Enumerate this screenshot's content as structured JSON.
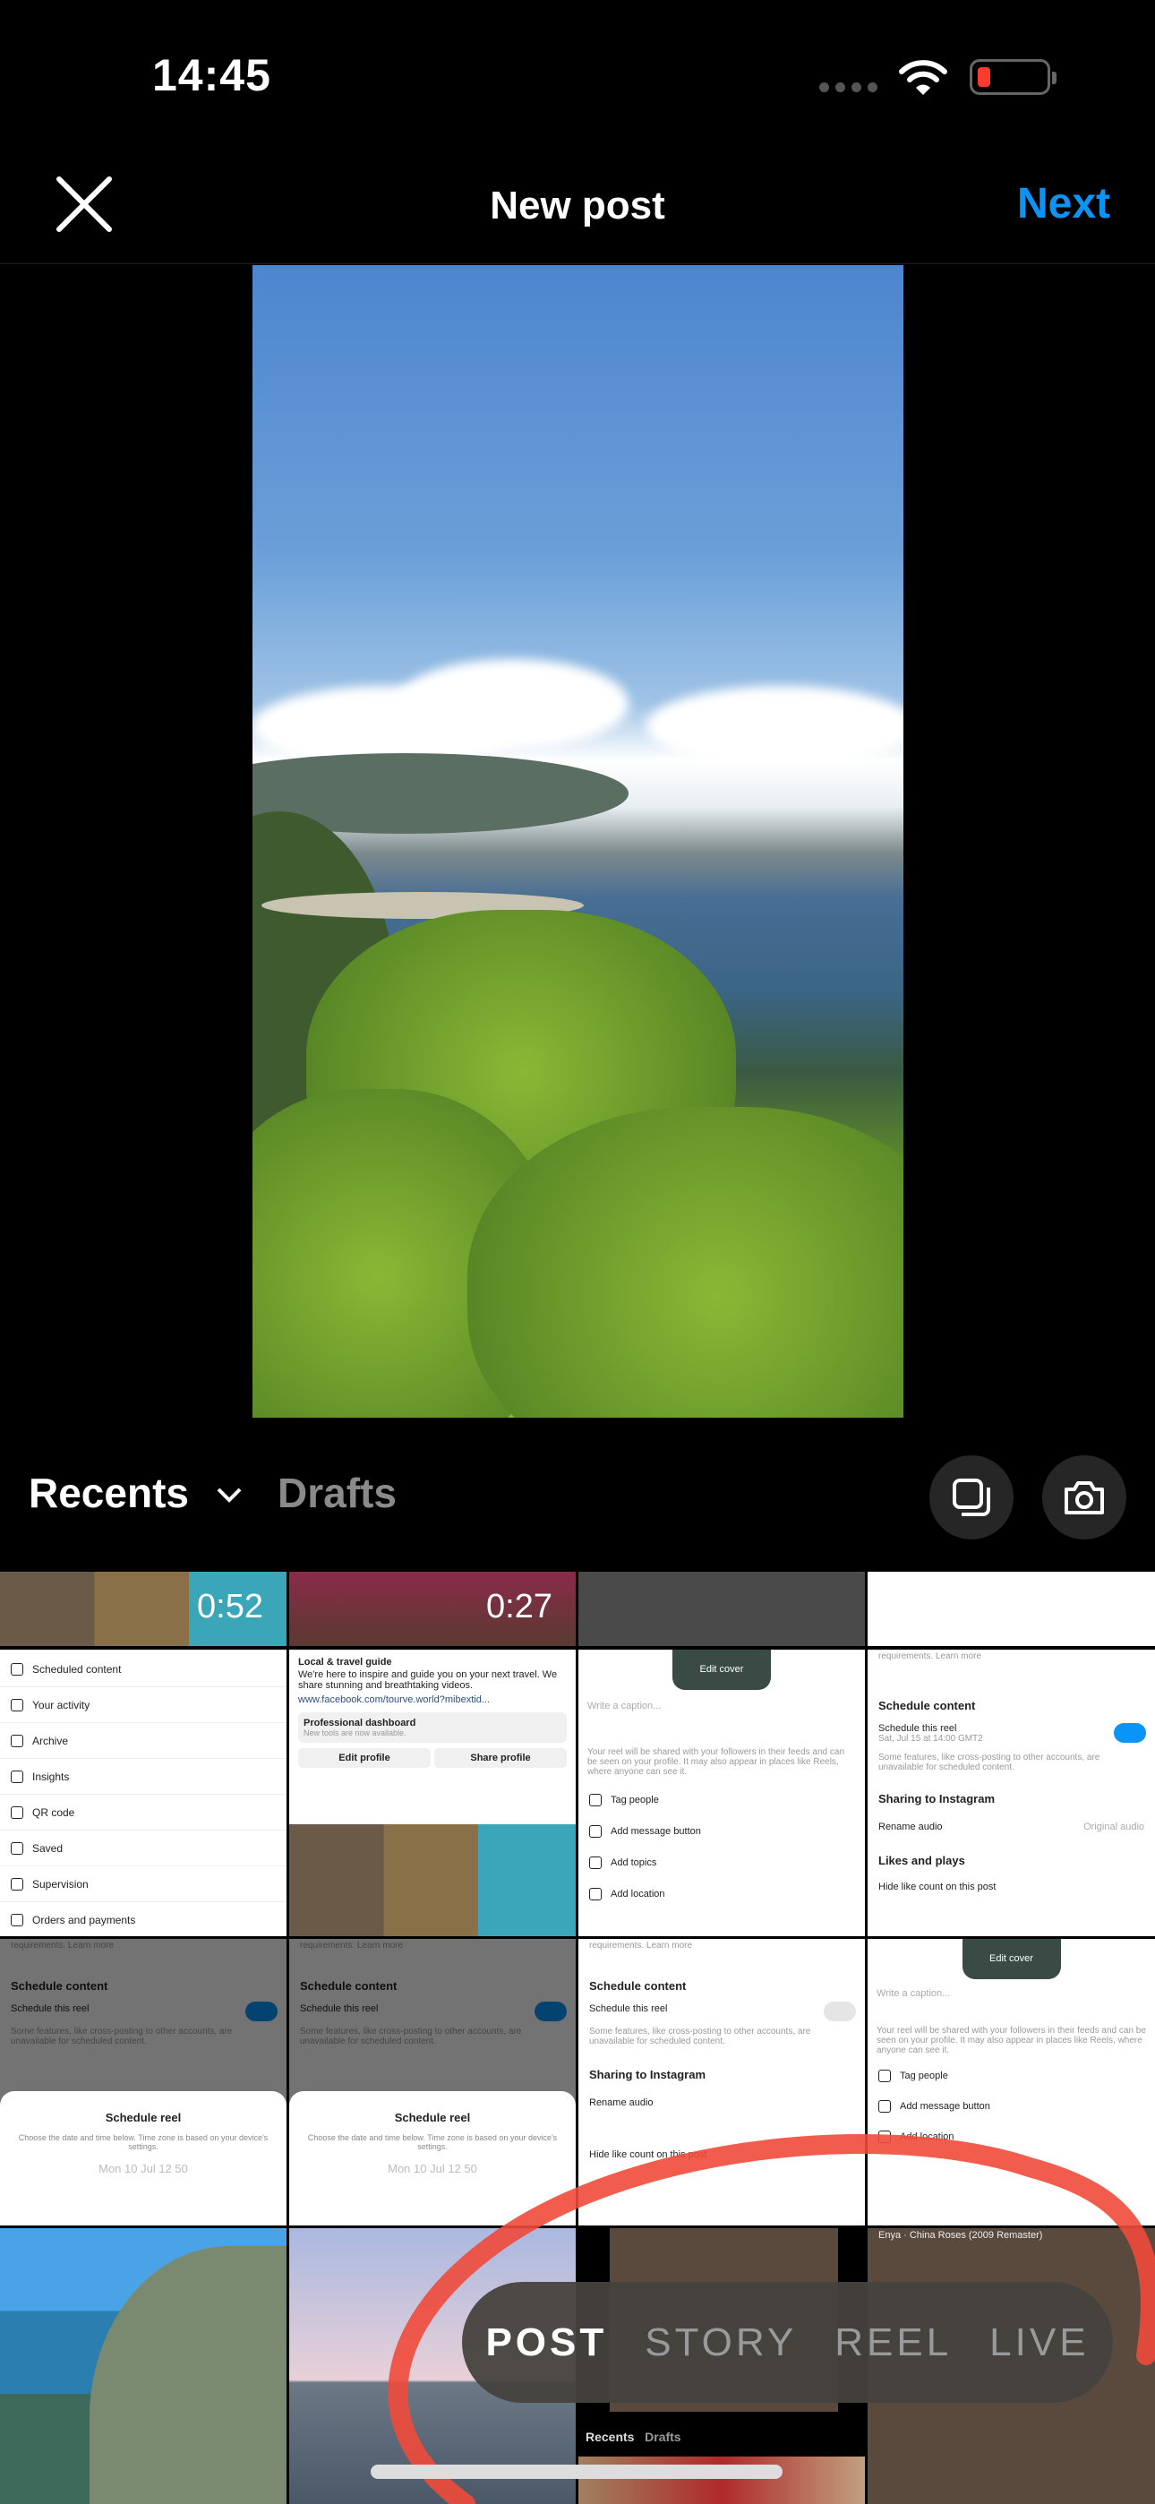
{
  "status_bar": {
    "time": "14:45",
    "battery_color": "#ff3b30"
  },
  "header": {
    "title": "New post",
    "next_label": "Next",
    "close_icon": "close-icon",
    "accent": "#0a95f6"
  },
  "gallery": {
    "album_label": "Recents",
    "drafts_label": "Drafts",
    "multi_select_icon": "multi-select-icon",
    "camera_icon": "camera-icon"
  },
  "thumbnails": {
    "durations": [
      "0:52",
      "0:27"
    ],
    "menu_items": [
      "Scheduled content",
      "Your activity",
      "Archive",
      "Insights",
      "QR code",
      "Saved",
      "Supervision",
      "Orders and payments"
    ],
    "profile": {
      "category": "Local & travel guide",
      "bio": "We're here to inspire and guide you on your next travel. We share stunning and breathtaking videos.",
      "link": "www.facebook.com/tourve.world?mibextid...",
      "dashboard": "Professional dashboard",
      "dashboard_sub": "New tools are now available.",
      "edit": "Edit profile",
      "share": "Share profile"
    },
    "reel_share": {
      "edit_cover": "Edit cover",
      "caption": "Write a caption...",
      "notice": "Your reel will be shared with your followers in their feeds and can be seen on your profile. It may also appear in places like Reels, where anyone can see it.",
      "rows": [
        "Tag people",
        "Add message button",
        "Add topics",
        "Add location"
      ]
    },
    "schedule": {
      "learn": "requirements. Learn more",
      "heading": "Schedule content",
      "toggle_label": "Schedule this reel",
      "toggle_sub": "Sat, Jul 15 at 14:00 GMT2",
      "note": "Some features, like cross-posting to other accounts, are unavailable for scheduled content.",
      "sharing": "Sharing to Instagram",
      "rename": "Rename audio",
      "original": "Original audio",
      "likes": "Likes and plays",
      "hide": "Hide like count on this post"
    },
    "sheet": {
      "title": "Schedule reel",
      "desc": "Choose the date and time below. Time zone is based on your device's settings.",
      "picker": "Mon 10 Jul   12   50"
    },
    "music": "Enya · China Roses (2009 Remaster)",
    "mini": {
      "recents": "Recents",
      "drafts": "Drafts"
    }
  },
  "modes": {
    "items": [
      "POST",
      "STORY",
      "REEL",
      "LIVE"
    ],
    "selected": "POST"
  },
  "annotation_color": "#f04a3a"
}
